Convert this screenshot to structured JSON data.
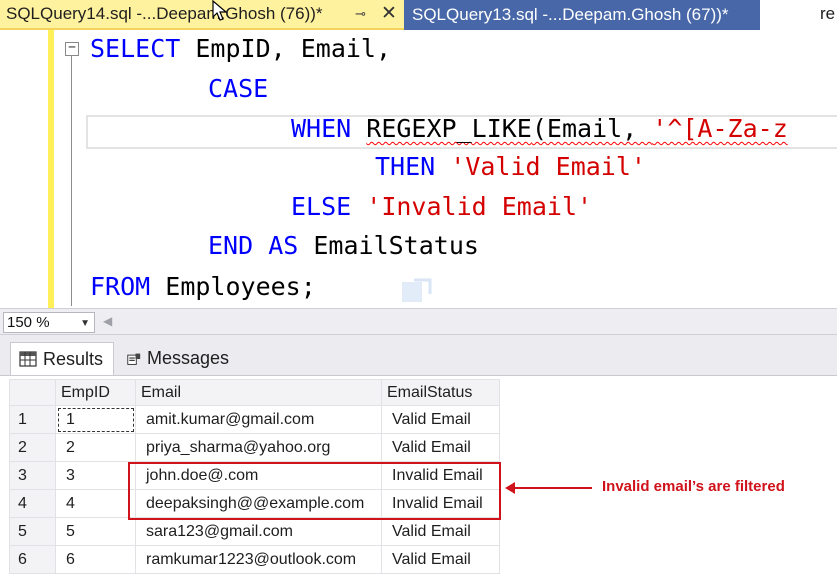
{
  "tabs": [
    {
      "title": "SQLQuery14.sql -...Deepam.Ghosh (76))*",
      "pin": "⊸",
      "close": "✕"
    },
    {
      "title": "SQLQuery13.sql -...Deepam.Ghosh (67))*"
    },
    {
      "title": "re"
    }
  ],
  "editor": {
    "collapse": "−",
    "line1": {
      "kw": "SELECT",
      "rest": " EmpID, Email,"
    },
    "line2": {
      "kw": "CASE"
    },
    "line3": {
      "kw": "WHEN",
      "fn": "REGEXP_LIKE",
      "rest": "(Email, ",
      "str": "'^[A-Za-z"
    },
    "line4": {
      "kw": "THEN",
      "str": "'Valid Email'"
    },
    "line5": {
      "kw": "ELSE",
      "str": "'Invalid Email'"
    },
    "line6": {
      "kw": "END AS",
      "rest": " EmailStatus"
    },
    "line7": {
      "kw": "FROM",
      "rest": " Employees;"
    }
  },
  "zoom": {
    "value": "150 %"
  },
  "result_tabs": {
    "results": "Results",
    "messages": "Messages"
  },
  "grid": {
    "columns": [
      "EmpID",
      "Email",
      "EmailStatus"
    ],
    "rows": [
      {
        "n": "1",
        "id": "1",
        "email": "amit.kumar@gmail.com",
        "status": "Valid Email"
      },
      {
        "n": "2",
        "id": "2",
        "email": "priya_sharma@yahoo.org",
        "status": "Valid Email"
      },
      {
        "n": "3",
        "id": "3",
        "email": "john.doe@.com",
        "status": "Invalid Email"
      },
      {
        "n": "4",
        "id": "4",
        "email": "deepaksingh@@example.com",
        "status": "Invalid Email"
      },
      {
        "n": "5",
        "id": "5",
        "email": "sara123@gmail.com",
        "status": "Valid Email"
      },
      {
        "n": "6",
        "id": "6",
        "email": "ramkumar1223@outlook.com",
        "status": "Valid Email"
      }
    ]
  },
  "annotation": {
    "text": "Invalid  email’s are filtered",
    "color": "#d0131b"
  },
  "colors": {
    "active_tab": "#fff29e",
    "inactive_tab": "#4767a8",
    "keyword": "#0000ff",
    "string": "#d40000"
  }
}
